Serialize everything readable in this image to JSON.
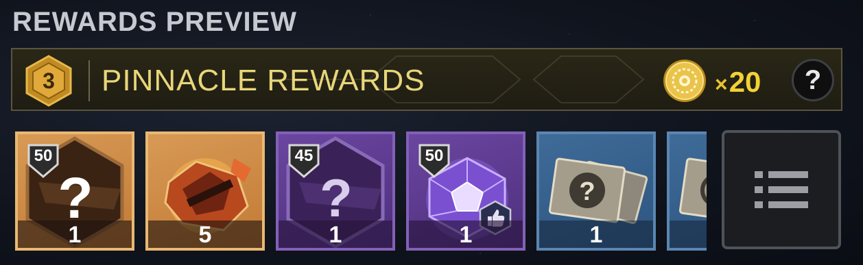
{
  "section_title": "REWARDS PREVIEW",
  "header": {
    "tier": "3",
    "title": "PINNACLE REWARDS",
    "currency_icon": "engram-coin-icon",
    "multiplier_prefix": "×",
    "multiplier_value": "20",
    "help_label": "?"
  },
  "rewards": [
    {
      "rarity": "exotic",
      "color": "#d79a55",
      "icon": "unknown-exotic-item-icon",
      "level": "50",
      "count": "1"
    },
    {
      "rarity": "exotic",
      "color": "#d79a55",
      "icon": "exotic-shard-icon",
      "level": "",
      "count": "5"
    },
    {
      "rarity": "legendary",
      "color": "#6b46a0",
      "icon": "unknown-legendary-item-icon",
      "level": "45",
      "count": "1"
    },
    {
      "rarity": "legendary",
      "color": "#6b46a0",
      "icon": "legendary-engram-icon",
      "level": "50",
      "count": "1"
    },
    {
      "rarity": "rare",
      "color": "#3f6b98",
      "icon": "unknown-rare-ticket-icon",
      "level": "",
      "count": "1"
    },
    {
      "rarity": "rare",
      "color": "#3f6b98",
      "icon": "rare-ticket-icon",
      "level": "",
      "count": ""
    }
  ],
  "list_button_icon": "list-icon"
}
